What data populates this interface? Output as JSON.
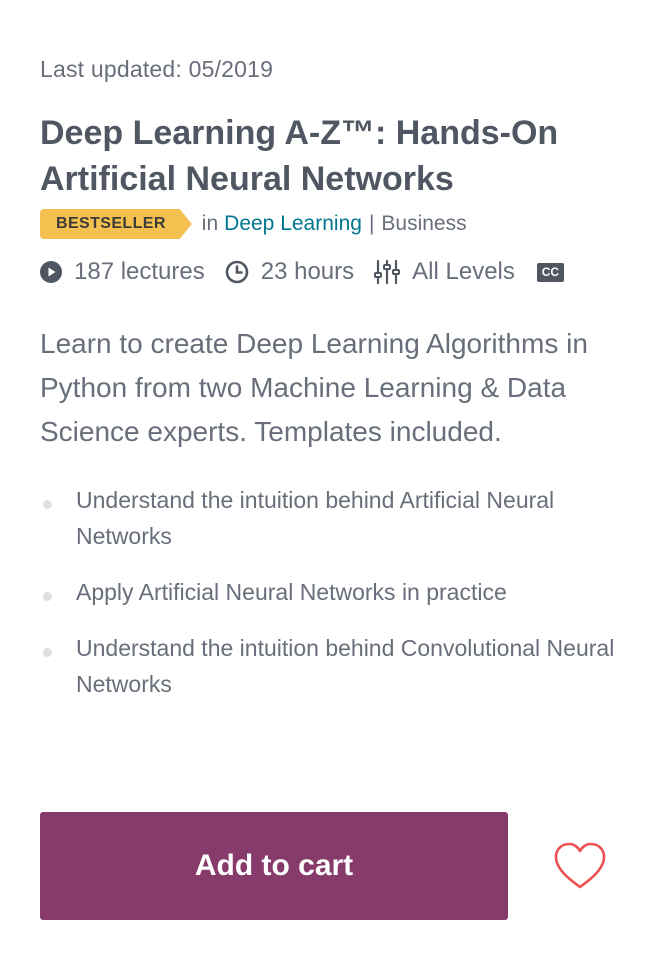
{
  "course": {
    "last_updated": "Last updated: 05/2019",
    "title": "Deep Learning A-Z™: Hands-On Artificial Neural Networks",
    "badge": "BESTSELLER",
    "in_label": "in",
    "category": "Deep Learning",
    "separator": "|",
    "parent_category": "Business",
    "lectures": "187 lectures",
    "hours": "23 hours",
    "level": "All Levels",
    "cc": "CC",
    "headline": "Learn to create Deep Learning Algorithms in Python from two Machine Learning & Data Science experts. Templates included.",
    "objectives": [
      "Understand the intuition behind Artificial Neural Networks",
      "Apply Artificial Neural Networks in practice",
      "Understand the intuition behind Convolutional Neural Networks"
    ],
    "cart_label": "Add to cart"
  },
  "icons": {
    "lectures": "play-circle-icon",
    "hours": "clock-icon",
    "level": "sliders-icon",
    "cc": "closed-captions-icon",
    "wishlist": "heart-outline-icon"
  },
  "colors": {
    "badge": "#f4c150",
    "link": "#007791",
    "cart_button": "#863b6b",
    "heart": "#ec5252"
  }
}
